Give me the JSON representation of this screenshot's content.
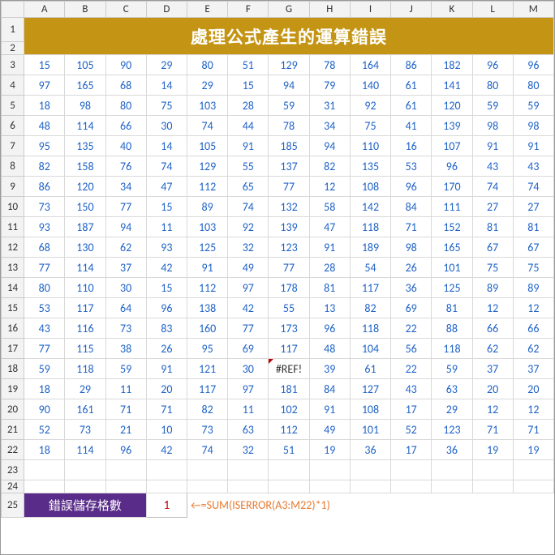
{
  "columns": [
    "A",
    "B",
    "C",
    "D",
    "E",
    "F",
    "G",
    "H",
    "I",
    "J",
    "K",
    "L",
    "M"
  ],
  "row_headers": [
    1,
    2,
    3,
    4,
    5,
    6,
    7,
    8,
    9,
    10,
    11,
    12,
    13,
    14,
    15,
    16,
    17,
    18,
    19,
    20,
    21,
    22,
    23,
    24,
    25
  ],
  "title": "處理公式產生的運算錯誤",
  "error_text": "#REF!",
  "footer": {
    "label": "錯誤儲存格數",
    "count": "1",
    "formula": "←=SUM(ISERROR(A3:M22)*1)"
  },
  "grid": [
    [
      15,
      105,
      90,
      29,
      80,
      51,
      129,
      78,
      164,
      86,
      182,
      96,
      96
    ],
    [
      97,
      165,
      68,
      14,
      29,
      15,
      94,
      79,
      140,
      61,
      141,
      80,
      80
    ],
    [
      18,
      98,
      80,
      75,
      103,
      28,
      59,
      31,
      92,
      61,
      120,
      59,
      59
    ],
    [
      48,
      114,
      66,
      30,
      74,
      44,
      78,
      34,
      75,
      41,
      139,
      98,
      98
    ],
    [
      95,
      135,
      40,
      14,
      105,
      91,
      185,
      94,
      110,
      16,
      107,
      91,
      91
    ],
    [
      82,
      158,
      76,
      74,
      129,
      55,
      137,
      82,
      135,
      53,
      96,
      43,
      43
    ],
    [
      86,
      120,
      34,
      47,
      112,
      65,
      77,
      12,
      108,
      96,
      170,
      74,
      74
    ],
    [
      73,
      150,
      77,
      15,
      89,
      74,
      132,
      58,
      142,
      84,
      111,
      27,
      27
    ],
    [
      93,
      187,
      94,
      11,
      103,
      92,
      139,
      47,
      118,
      71,
      152,
      81,
      81
    ],
    [
      68,
      130,
      62,
      93,
      125,
      32,
      123,
      91,
      189,
      98,
      165,
      67,
      67
    ],
    [
      77,
      114,
      37,
      42,
      91,
      49,
      77,
      28,
      54,
      26,
      101,
      75,
      75
    ],
    [
      80,
      110,
      30,
      15,
      112,
      97,
      178,
      81,
      117,
      36,
      125,
      89,
      89
    ],
    [
      53,
      117,
      64,
      96,
      138,
      42,
      55,
      13,
      82,
      69,
      81,
      12,
      12
    ],
    [
      43,
      116,
      73,
      83,
      160,
      77,
      173,
      96,
      118,
      22,
      88,
      66,
      66
    ],
    [
      77,
      115,
      38,
      26,
      95,
      69,
      117,
      48,
      104,
      56,
      118,
      62,
      62
    ],
    [
      59,
      118,
      59,
      91,
      121,
      30,
      "ERR",
      39,
      61,
      22,
      59,
      37,
      37
    ],
    [
      18,
      29,
      11,
      20,
      117,
      97,
      181,
      84,
      127,
      43,
      63,
      20,
      20
    ],
    [
      90,
      161,
      71,
      71,
      82,
      11,
      102,
      91,
      108,
      17,
      29,
      12,
      12
    ],
    [
      52,
      73,
      21,
      10,
      73,
      63,
      112,
      49,
      101,
      52,
      123,
      71,
      71
    ],
    [
      18,
      114,
      96,
      42,
      74,
      32,
      51,
      19,
      36,
      17,
      36,
      19,
      19
    ]
  ]
}
